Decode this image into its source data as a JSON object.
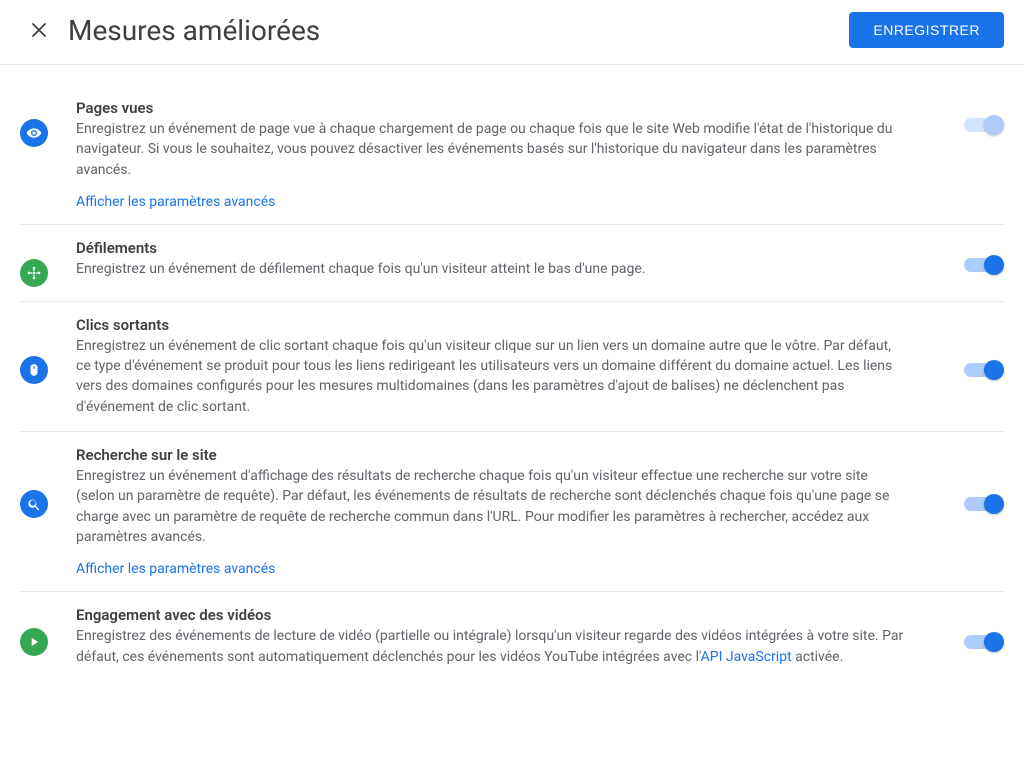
{
  "header": {
    "title": "Mesures améliorées",
    "save_label": "ENREGISTRER"
  },
  "items": [
    {
      "title": "Pages vues",
      "desc": "Enregistrez un événement de page vue à chaque chargement de page ou chaque fois que le site Web modifie l'état de l'historique du navigateur. Si vous le souhaitez, vous pouvez désactiver les événements basés sur l'historique du navigateur dans les paramètres avancés.",
      "advanced": "Afficher les paramètres avancés",
      "toggle_state": "on-disabled",
      "icon": "eye",
      "icon_bg": "blue"
    },
    {
      "title": "Défilements",
      "desc": "Enregistrez un événement de défilement chaque fois qu'un visiteur atteint le bas d'une page.",
      "toggle_state": "on",
      "icon": "scroll",
      "icon_bg": "green"
    },
    {
      "title": "Clics sortants",
      "desc": "Enregistrez un événement de clic sortant chaque fois qu'un visiteur clique sur un lien vers un domaine autre que le vôtre. Par défaut, ce type d'événement se produit pour tous les liens redirigeant les utilisateurs vers un domaine différent du domaine actuel. Les liens vers des domaines configurés pour les mesures multidomaines (dans les paramètres d'ajout de balises) ne déclenchent pas d'événement de clic sortant.",
      "toggle_state": "on",
      "icon": "mouse",
      "icon_bg": "blue"
    },
    {
      "title": "Recherche sur le site",
      "desc": "Enregistrez un événement d'affichage des résultats de recherche chaque fois qu'un visiteur effectue une recherche sur votre site (selon un paramètre de requête). Par défaut, les événements de résultats de recherche sont déclenchés chaque fois qu'une page se charge avec un paramètre de requête de recherche commun dans l'URL. Pour modifier les paramètres à rechercher, accédez aux paramètres avancés.",
      "advanced": "Afficher les paramètres avancés",
      "toggle_state": "on",
      "icon": "search",
      "icon_bg": "blue"
    },
    {
      "title": "Engagement avec des vidéos",
      "desc_prefix": "Enregistrez des événements de lecture de vidéo (partielle ou intégrale) lorsqu'un visiteur regarde des vidéos intégrées à votre site. Par défaut, ces événements sont automatiquement déclenchés pour les vidéos YouTube intégrées avec l'",
      "api_link": "API JavaScript",
      "desc_suffix": " activée.",
      "toggle_state": "on",
      "icon": "play",
      "icon_bg": "green"
    }
  ]
}
